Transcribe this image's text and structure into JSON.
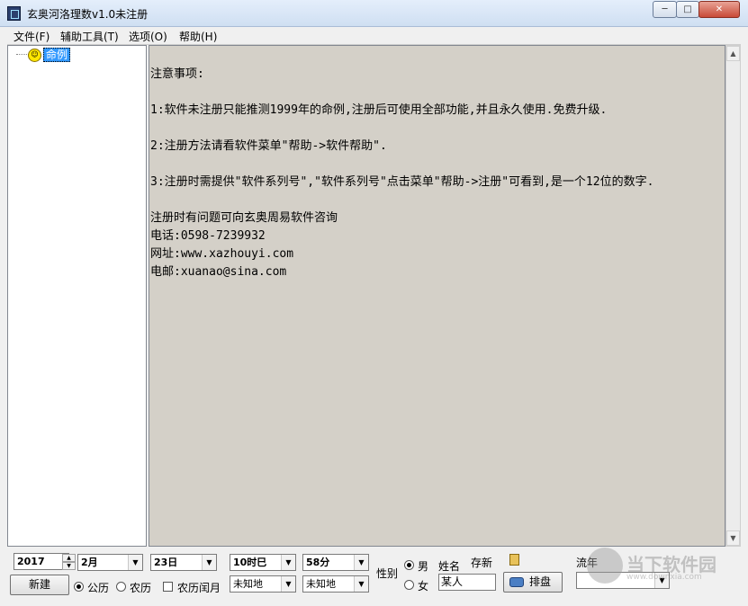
{
  "window": {
    "title": "玄奥河洛理数v1.0未注册",
    "min_label": "─",
    "max_label": "□",
    "close_label": "✕"
  },
  "menu": [
    "文件(F)",
    "辅助工具(T)",
    "选项(O)",
    "帮助(H)"
  ],
  "tree": {
    "root_label": "命例"
  },
  "content": {
    "text": "注意事项:\n\n1:软件未注册只能推测1999年的命例,注册后可使用全部功能,并且永久使用.免费升级.\n\n2:注册方法请看软件菜单\"帮助->软件帮助\".\n\n3:注册时需提供\"软件系列号\",\"软件系列号\"点击菜单\"帮助->注册\"可看到,是一个12位的数字.\n\n注册时有问题可向玄奥周易软件咨询\n电话:0598-7239932\n网址:www.xazhouyi.com\n电邮:xuanao@sina.com"
  },
  "bottom": {
    "year": "2017",
    "month": "2月",
    "day": "23日",
    "hour": "10时巳",
    "minute": "58分",
    "place1": "未知地",
    "place2": "未知地",
    "new_button": "新建",
    "calendar_options": [
      "公历",
      "农历",
      "农历闰月"
    ],
    "calendar_selected": "公历",
    "gender_label": "性别",
    "gender_options": [
      "男",
      "女"
    ],
    "gender_selected": "男",
    "name_label": "姓名",
    "name_value": "某人",
    "save_label": "存新",
    "chart_button": "排盘",
    "liunian_label": "流年",
    "liunian_value": ""
  },
  "watermark": {
    "text": "当下软件园",
    "sub": "www.downxia.com"
  },
  "colors": {
    "content_bg": "#d4d0c8",
    "selection": "#3399ff",
    "title_gradient": "#dce8f7"
  }
}
